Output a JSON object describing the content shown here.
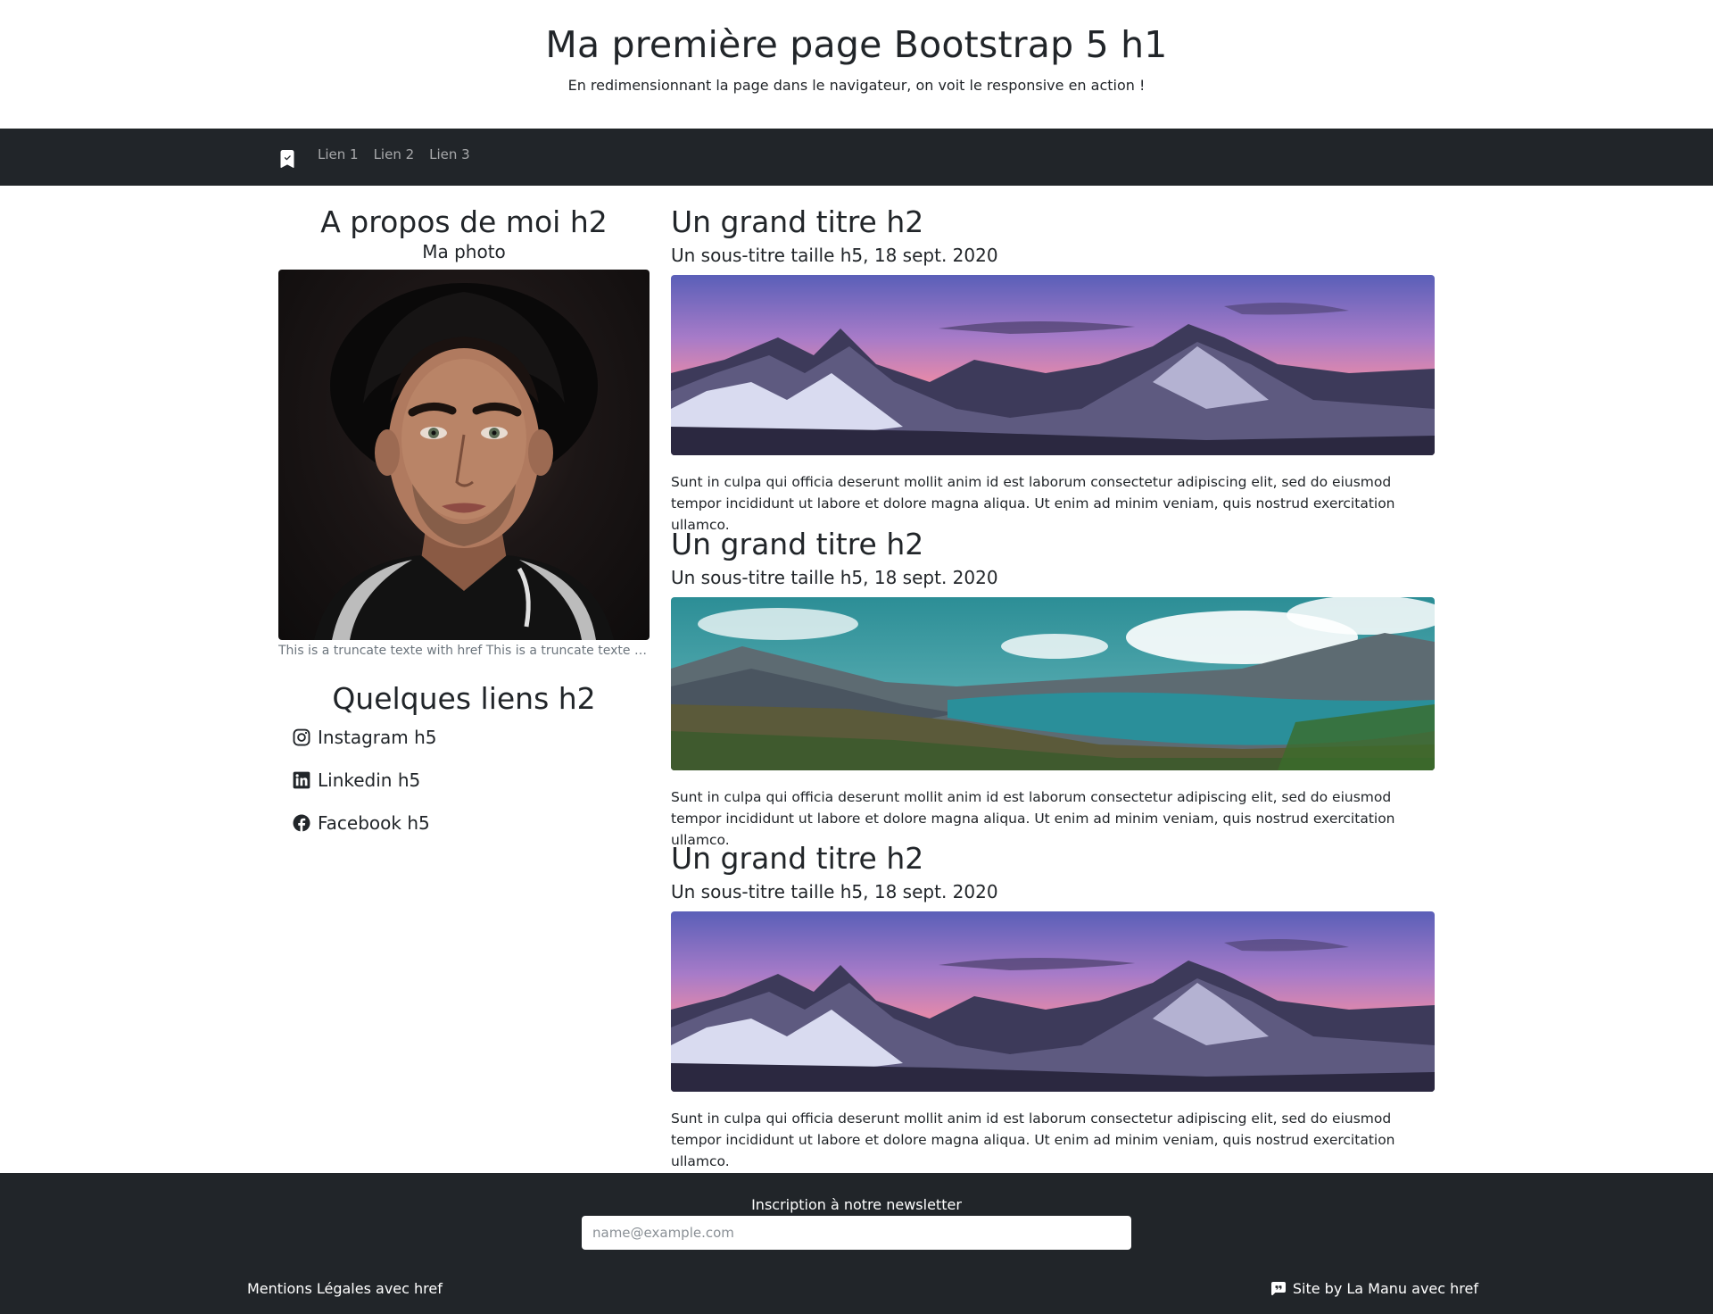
{
  "header": {
    "title": "Ma première page Bootstrap 5 h1",
    "lead": "En redimensionnant la page dans le navigateur, on voit le responsive en action !"
  },
  "navbar": {
    "brand_icon": "bookmark-check-icon",
    "links": [
      "Lien 1",
      "Lien 2",
      "Lien 3"
    ]
  },
  "aside": {
    "about_title": "A propos de moi h2",
    "photo_label": "Ma photo",
    "truncate_text": "This is a truncate texte with href This is a truncate texte This is a truncate texte",
    "links_title": "Quelques liens h2",
    "social": [
      {
        "label": "Instagram h5",
        "icon": "instagram-icon"
      },
      {
        "label": "Linkedin h5",
        "icon": "linkedin-icon"
      },
      {
        "label": "Facebook h5",
        "icon": "facebook-icon"
      }
    ]
  },
  "articles": [
    {
      "title": "Un grand titre h2",
      "subtitle": "Un sous-titre taille h5, 18 sept. 2020",
      "body": "Sunt in culpa qui officia deserunt mollit anim id est laborum consectetur adipiscing elit, sed do eiusmod tempor incididunt ut labore et dolore magna aliqua. Ut enim ad minim veniam, quis nostrud exercitation ullamco."
    },
    {
      "title": "Un grand titre h2",
      "subtitle": "Un sous-titre taille h5, 18 sept. 2020",
      "body": "Sunt in culpa qui officia deserunt mollit anim id est laborum consectetur adipiscing elit, sed do eiusmod tempor incididunt ut labore et dolore magna aliqua. Ut enim ad minim veniam, quis nostrud exercitation ullamco."
    },
    {
      "title": "Un grand titre h2",
      "subtitle": "Un sous-titre taille h5, 18 sept. 2020",
      "body": "Sunt in culpa qui officia deserunt mollit anim id est laborum consectetur adipiscing elit, sed do eiusmod tempor incididunt ut labore et dolore magna aliqua. Ut enim ad minim veniam, quis nostrud exercitation ullamco."
    }
  ],
  "footer": {
    "newsletter_label": "Inscription à notre newsletter",
    "newsletter_placeholder": "name@example.com",
    "legal_link": "Mentions Légales avec href",
    "credit_link": "Site by La Manu avec href",
    "credit_icon": "chat-quote-icon"
  },
  "colors": {
    "dark": "#212529",
    "muted": "#6c757d",
    "nav_link": "rgba(255,255,255,0.6)"
  }
}
